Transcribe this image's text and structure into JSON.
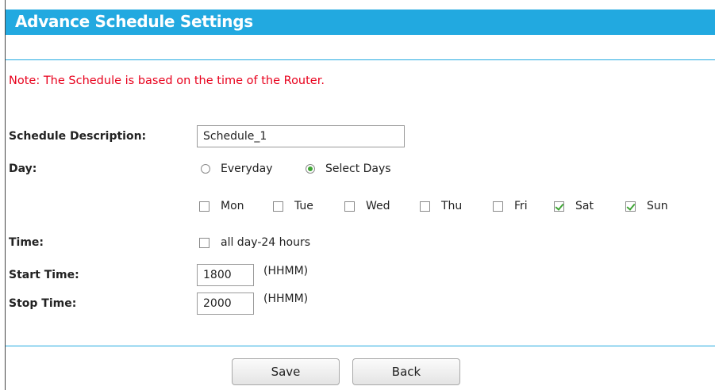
{
  "header": {
    "title": "Advance Schedule Settings"
  },
  "note": "Note: The Schedule is based on the time of the Router.",
  "form": {
    "description": {
      "label": "Schedule Description:",
      "value": "Schedule_1"
    },
    "day": {
      "label": "Day:",
      "options": [
        {
          "label": "Everyday",
          "selected": false
        },
        {
          "label": "Select Days",
          "selected": true
        }
      ],
      "days": [
        {
          "label": "Mon",
          "checked": false
        },
        {
          "label": "Tue",
          "checked": false
        },
        {
          "label": "Wed",
          "checked": false
        },
        {
          "label": "Thu",
          "checked": false
        },
        {
          "label": "Fri",
          "checked": false
        },
        {
          "label": "Sat",
          "checked": true
        },
        {
          "label": "Sun",
          "checked": true
        }
      ]
    },
    "time": {
      "label": "Time:",
      "allday_label": "all day-24 hours",
      "allday_checked": false
    },
    "start": {
      "label": "Start Time:",
      "value": "1800",
      "hint": "(HHMM)"
    },
    "stop": {
      "label": "Stop Time:",
      "value": "2000",
      "hint": "(HHMM)"
    }
  },
  "buttons": {
    "save": "Save",
    "back": "Back"
  },
  "colors": {
    "accent": "#22a9e0",
    "note": "#e8001c",
    "check": "#3fa535"
  }
}
